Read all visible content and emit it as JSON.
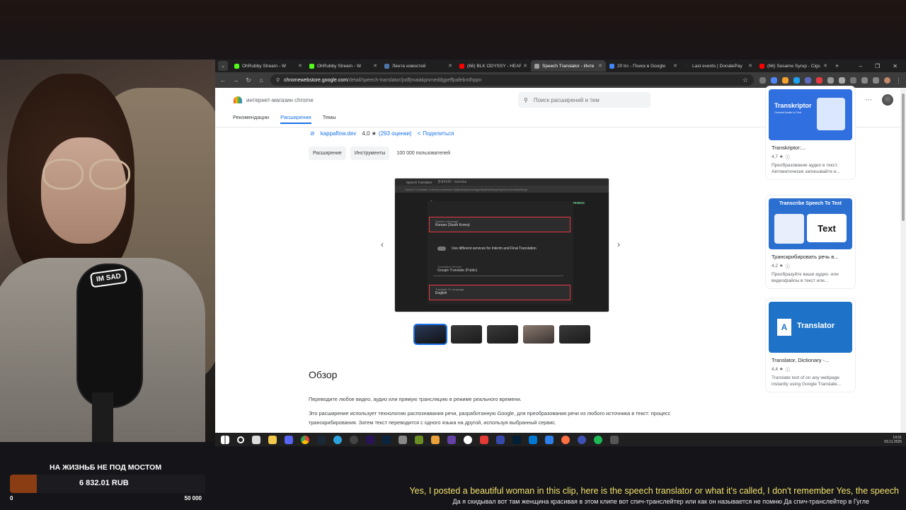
{
  "browser": {
    "tabs": [
      {
        "title": "OhRubby Stream - W",
        "color": "#53fc18",
        "active": false
      },
      {
        "title": "OhRubby Stream - W",
        "color": "#53fc18",
        "active": false
      },
      {
        "title": "Лента новостей",
        "color": "#4a76a8",
        "active": false
      },
      {
        "title": "(66) BLK ODYSSY - HEAR",
        "color": "#ff0000",
        "active": false
      },
      {
        "title": "Speech Translator - Инте",
        "color": "#9e9e9e",
        "active": true
      },
      {
        "title": "20 trc - Поиск в Google",
        "color": "#4285f4",
        "active": false
      },
      {
        "title": "Last events | DonatePay",
        "color": "#222222",
        "active": false
      },
      {
        "title": "(66) Sesame Syrup - Cigs",
        "color": "#ff0000",
        "active": false
      }
    ],
    "url_host": "chromewebstore.google.com",
    "url_path": "/detail/speech-translator/jodfjmaiakpnmeddgpeffpafebmlhppn"
  },
  "store": {
    "logo_text": "интернет-магазин chrome",
    "search_placeholder": "Поиск расширений и тем",
    "nav": [
      "Рекомендации",
      "Расширения",
      "Темы"
    ],
    "developer": "kappaflow.dev",
    "rating": "4,0 ★",
    "reviews": "(293 оценки)",
    "share": "Поделиться",
    "chips": [
      "Расширение",
      "Инструменты"
    ],
    "users": "100 000 пользователей",
    "overview_title": "Обзор",
    "para1": "Переводите любое видео, аудио или прямую трансляцию в режиме реального времени.",
    "para2": "Это расширение использует технологию распознавания речи, разработанную Google, для преобразования речи из любого источника в текст: процесс транскрибирования. Затем текст переводится с одного языка на другой, используя выбранный сервис."
  },
  "screenshot": {
    "tab1": "Speech Translator",
    "tab2": "한국어/조/ - YouTube",
    "url": "Speech Translator | chrome-extension://jdfjmaiakpnmeddgpeffpafebmlhppn/options.html#/settings",
    "start": "START LISTENING",
    "speech_language_label": "Speech Language",
    "speech_language_value": "Korean (South Korea)",
    "toggle_text": "Use different services for Interim and Final Translation",
    "service_label": "Translation Service",
    "service_value": "Google Translate (Public)",
    "translate_label": "Translate To Language",
    "translate_value": "English"
  },
  "cards": [
    {
      "name": "Transkriptor:...",
      "rating": "4,7 ★",
      "desc": "Преобразование аудио в текст. Автоматически записывайте и...",
      "image_title": "Transkriptor",
      "image_sub": "Convert Audio to Text",
      "bg": "#2f6fe0"
    },
    {
      "name": "Транскрибировать речь в...",
      "rating": "4,2 ★",
      "desc": "Преобразуйте ваши аудио- или видеофайлы в текст или...",
      "image_title": "Transcribe Speech To Text",
      "image_sub": "Text",
      "bg": "#2b6fd1"
    },
    {
      "name": "Translator, Dictionary -...",
      "rating": "4,4 ★",
      "desc": "Translate text of on any webpage instantly using Google Translate...",
      "image_title": "Translator",
      "image_sub": "A",
      "bg": "#1e73c8"
    }
  ],
  "taskbar": {
    "time": "14:31",
    "date": "03.11.2025"
  },
  "stream": {
    "mic_tag": "IM SAD",
    "donate_title": "НА ЖИЗНЬБ НЕ ПОД МОСТОМ",
    "donate_amount": "6 832.01 RUB",
    "donate_min": "0",
    "donate_max": "50 000",
    "donate_progress": 0.1366,
    "subtitle_en": "Yes, I posted a beautiful woman in this clip, here is the speech translator or what it's called, I don't remember Yes, the speech",
    "subtitle_ru": "Да я скидывал вот там женщина красивая в этом клипе вот спич-транслейтер или как он называется не помню Да спич-транслейтер в Гугле"
  }
}
